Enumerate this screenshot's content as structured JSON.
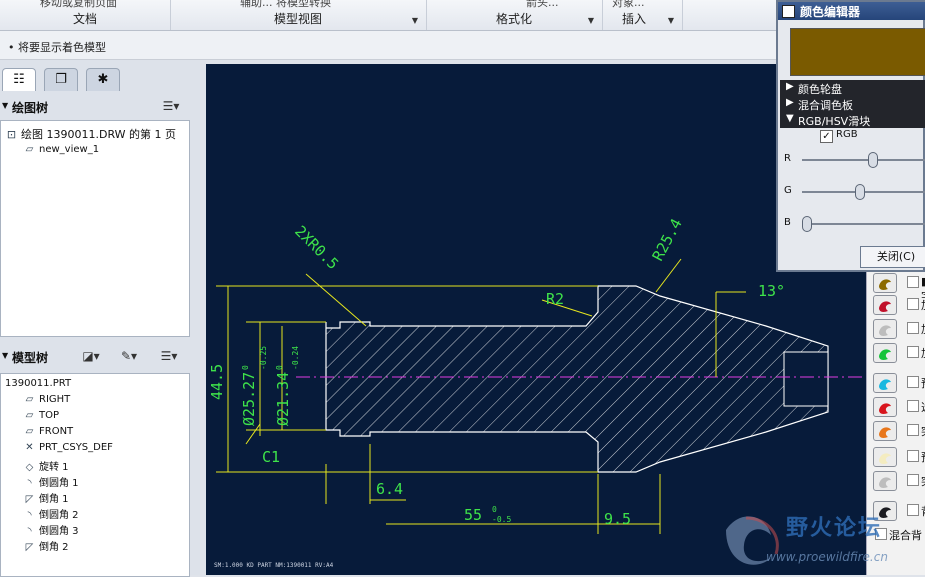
{
  "ribbon": {
    "groups": [
      {
        "label": "文档",
        "top_text": "移动或复制页面"
      },
      {
        "label": "模型视图",
        "top_text": "辅助...   将模型转换"
      },
      {
        "label": "格式化",
        "top_text": "箭头..."
      },
      {
        "label": "插入",
        "top_text": "对象..."
      }
    ]
  },
  "status": {
    "message": "• 将要显示着色模型"
  },
  "drawing_tree": {
    "title": "绘图树",
    "items": [
      "绘图 1390011.DRW 的第 1 页",
      "new_view_1"
    ]
  },
  "model_tree": {
    "title": "模型树",
    "items": [
      "1390011.PRT",
      "RIGHT",
      "TOP",
      "FRONT",
      "PRT_CSYS_DEF",
      "旋转 1",
      "倒圆角 1",
      "倒角 1",
      "倒圆角 2",
      "倒圆角 3",
      "倒角 2"
    ]
  },
  "drawing": {
    "dims": [
      "2XR0.5",
      "R25.4",
      "R2",
      "13°",
      "44.5",
      "Ø25.27",
      "Ø21.34",
      "C1",
      "6.4",
      "55",
      "9.5",
      "0",
      "-0.25",
      "0",
      "-0.24",
      "0",
      "-0.5"
    ],
    "footer": "SM:1.000   KD PART   NM:1390011   RV:A4"
  },
  "color_editor": {
    "title": "颜色编辑器",
    "swatch_color": "#7a5a00",
    "sections": [
      "颜色轮盘",
      "混合调色板",
      "RGB/HSV滑块"
    ],
    "rgb_checkbox_label": "RGB",
    "rgb_checked": true,
    "sliders": [
      {
        "label": "R",
        "value": 0.55
      },
      {
        "label": "G",
        "value": 0.44
      },
      {
        "label": "B",
        "value": 0.0
      }
    ],
    "close_label": "关闭(C)"
  },
  "appearance_list": {
    "rows": [
      {
        "swatch": "#8b6a00",
        "text": "■ 字"
      },
      {
        "swatch": "#c0102a",
        "text": "加"
      },
      {
        "swatch": "#bdbdbd",
        "text": "加"
      },
      {
        "swatch": "#16c43a",
        "text": "加"
      },
      {
        "swatch": "#19b8e0",
        "text": "预"
      },
      {
        "swatch": "#d8141c",
        "text": "选"
      },
      {
        "swatch": "#e8761a",
        "text": "突"
      },
      {
        "swatch": "#f4ecc0",
        "text": "预"
      },
      {
        "swatch": "#bdbdbd",
        "text": "突"
      },
      {
        "swatch": "#1b1b20",
        "text": "背"
      },
      {
        "swatch": "",
        "text": "混合背"
      }
    ]
  },
  "watermark": {
    "text": "野火论坛",
    "url": "www.proewildfire.cn"
  },
  "colors": {
    "canvas_bg": "#071b3a",
    "geometry": "#ffffff",
    "dimension": "#e6e61e",
    "annotation": "#3ee34a",
    "centerline": "#e23be2"
  }
}
